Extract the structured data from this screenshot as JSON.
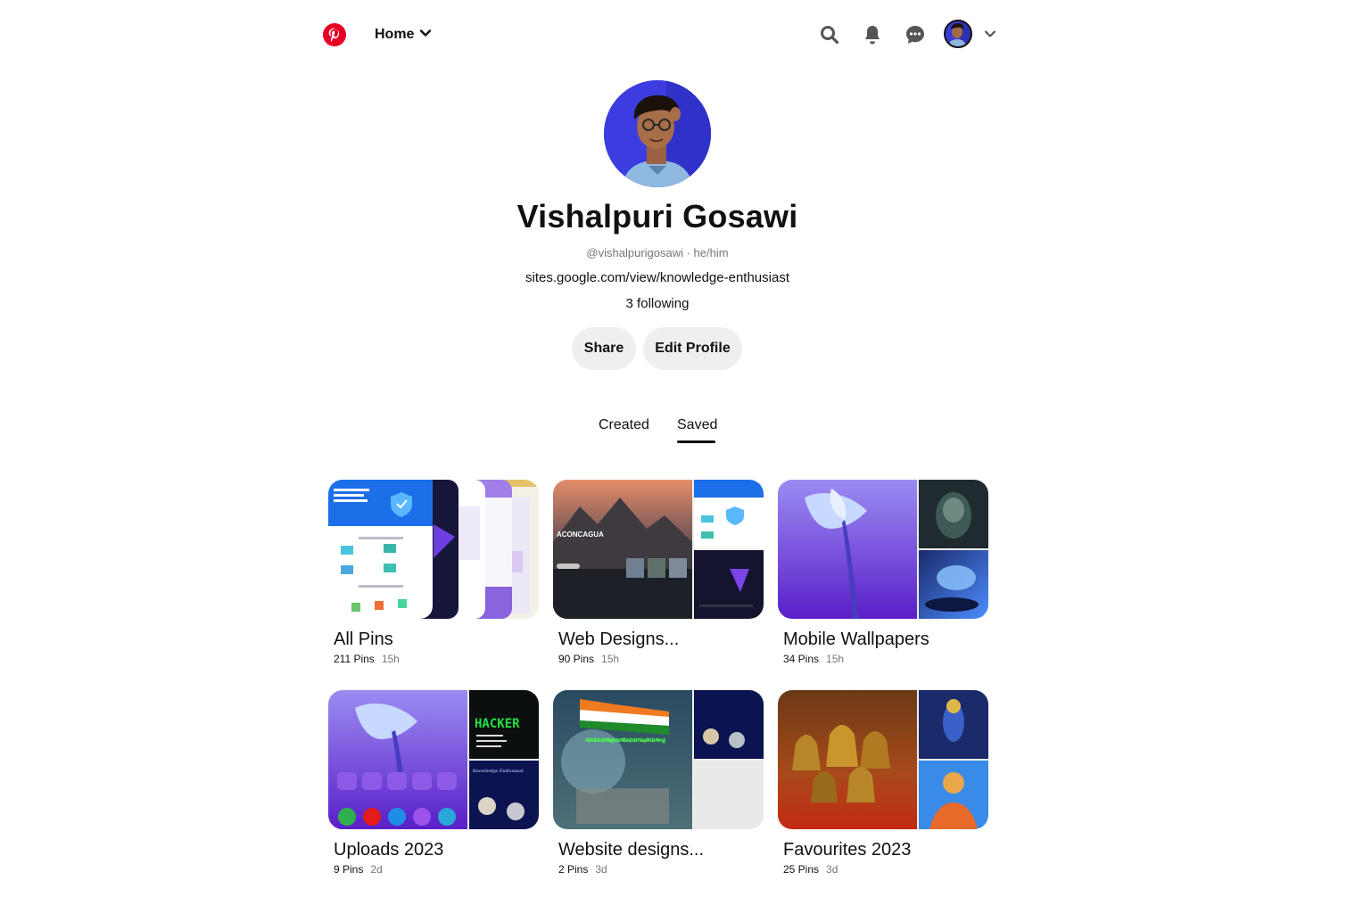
{
  "header": {
    "home_label": "Home"
  },
  "profile": {
    "name": "Vishalpuri Gosawi",
    "handle": "@vishalpurigosawi · he/him",
    "website": "sites.google.com/view/knowledge-enthusiast",
    "following": "3 following",
    "share_label": "Share",
    "edit_label": "Edit Profile"
  },
  "tabs": {
    "created": "Created",
    "saved": "Saved",
    "active": "Saved"
  },
  "boards": [
    {
      "title": "All Pins",
      "pins": "211 Pins",
      "ago": "15h"
    },
    {
      "title": "Web Designs...",
      "pins": "90 Pins",
      "ago": "15h"
    },
    {
      "title": "Mobile Wallpapers",
      "pins": "34 Pins",
      "ago": "15h"
    },
    {
      "title": "Uploads 2023",
      "pins": "9 Pins",
      "ago": "2d"
    },
    {
      "title": "Website designs...",
      "pins": "2 Pins",
      "ago": "3d"
    },
    {
      "title": "Favourites 2023",
      "pins": "25 Pins",
      "ago": "3d"
    }
  ],
  "cover_text": {
    "aconcagua": "ACONCAGUA",
    "hacker": "HACKER",
    "military": "Pride of the India Military (Indian Airforce, Indian Navy & Indian Army)",
    "knowledge": "Knowledge Enthusiast"
  },
  "colors": {
    "brand": "#e60023",
    "button_bg": "#efefef",
    "text": "#111111",
    "muted": "#767676"
  },
  "icons": [
    "pinterest-logo-icon",
    "chevron-down-icon",
    "search-icon",
    "bell-icon",
    "chat-icon",
    "avatar",
    "chevron-down-icon"
  ]
}
